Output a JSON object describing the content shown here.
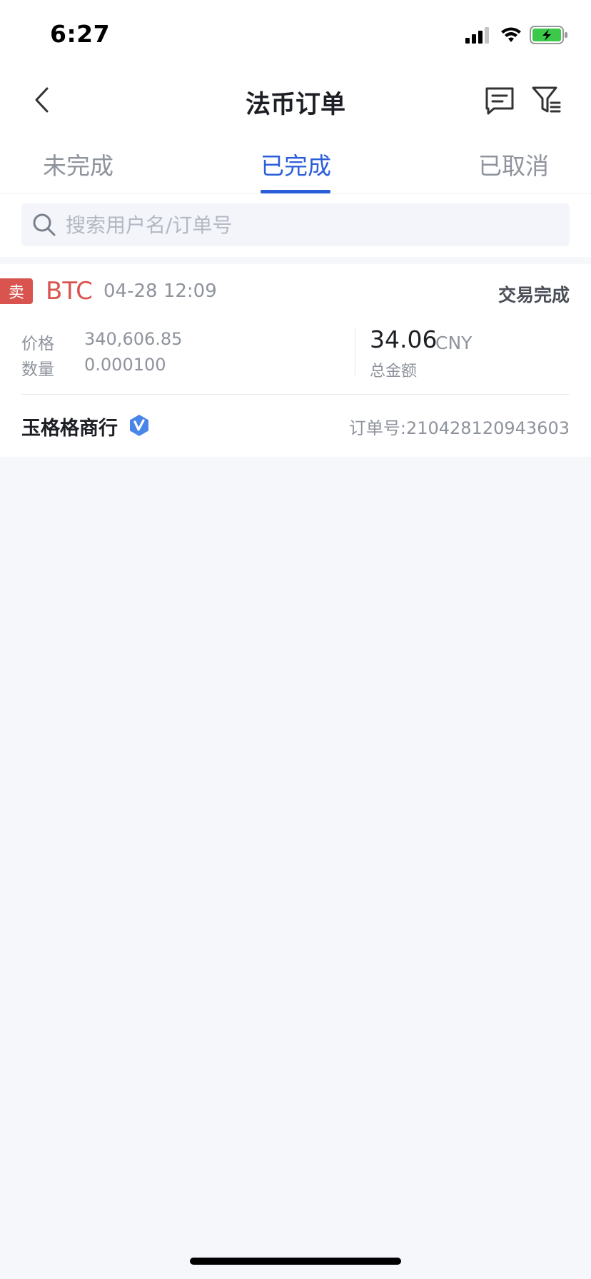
{
  "status_bar": {
    "time": "6:27"
  },
  "nav": {
    "title": "法币订单"
  },
  "tabs": [
    {
      "label": "未完成"
    },
    {
      "label": "已完成",
      "active": true
    },
    {
      "label": "已取消"
    }
  ],
  "search": {
    "placeholder": "搜索用户名/订单号"
  },
  "orders": [
    {
      "side": "卖",
      "coin": "BTC",
      "time": "04-28 12:09",
      "status": "交易完成",
      "price_label": "价格",
      "price": "340,606.85",
      "quantity_label": "数量",
      "quantity": "0.000100",
      "total": "34.06",
      "currency": "CNY",
      "total_label": "总金额",
      "merchant": "玉格格商行",
      "order_no": "订单号:210428120943603"
    }
  ],
  "colors": {
    "accent": "#2b5fd9",
    "sell": "#d9534f",
    "verified": "#4a86e8",
    "battery": "#3cc94a"
  }
}
